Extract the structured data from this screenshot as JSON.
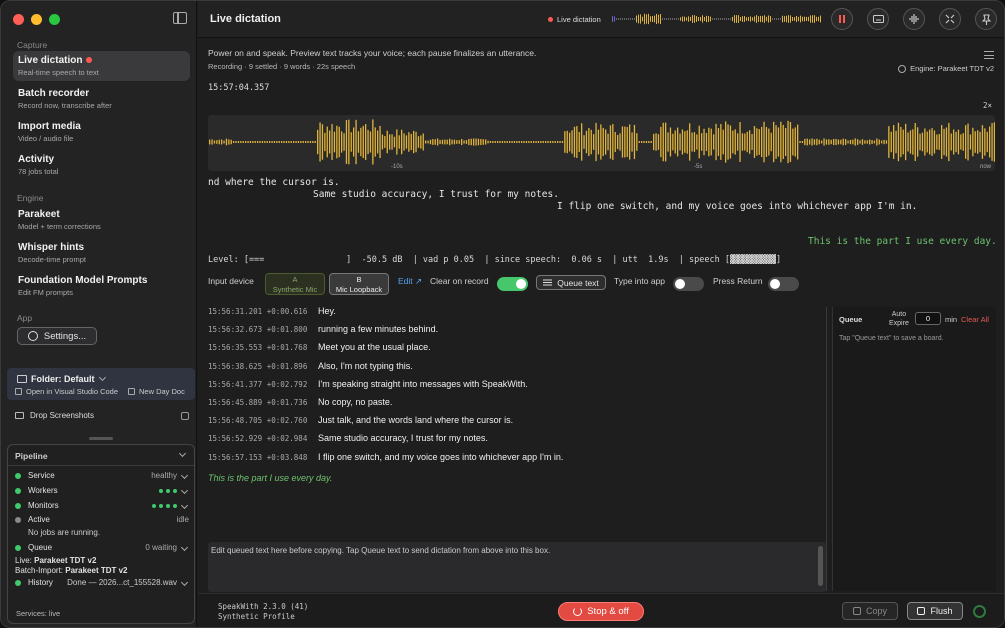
{
  "window": {
    "title": "Live dictation",
    "live_indicator": "Live dictation"
  },
  "sidebar": {
    "sections": {
      "capture": "Capture",
      "engine": "Engine",
      "app": "App"
    },
    "capture_items": [
      {
        "title": "Live dictation",
        "subtitle": "Real-time speech to text"
      },
      {
        "title": "Batch recorder",
        "subtitle": "Record now, transcribe after"
      },
      {
        "title": "Import media",
        "subtitle": "Video / audio file"
      },
      {
        "title": "Activity",
        "subtitle": "78 jobs total"
      }
    ],
    "engine_items": [
      {
        "title": "Parakeet",
        "subtitle": "Model + term corrections"
      },
      {
        "title": "Whisper hints",
        "subtitle": "Decode-time prompt"
      },
      {
        "title": "Foundation Model Prompts",
        "subtitle": "Edit FM prompts"
      }
    ],
    "settings_label": "Settings...",
    "folder": {
      "label": "Folder: Default",
      "open_vscode": "Open in Visual Studio Code",
      "new_day_doc": "New Day Doc"
    },
    "drop_screenshots": "Drop Screenshots",
    "pipeline": {
      "title": "Pipeline",
      "service": {
        "label": "Service",
        "value": "healthy"
      },
      "workers": {
        "label": "Workers"
      },
      "monitors": {
        "label": "Monitors"
      },
      "active": {
        "label": "Active",
        "value": "idle",
        "note": "No jobs are running."
      },
      "queue": {
        "label": "Queue",
        "value": "0 waiting"
      },
      "live_model_label": "Live:",
      "live_model": "Parakeet TDT v2",
      "batch_model_label": "Batch-Import:",
      "batch_model": "Parakeet TDT v2",
      "history": {
        "label": "History",
        "value": "Done — 2026...ct_155528.wav"
      }
    },
    "services": "Services: live"
  },
  "main": {
    "subtitle": "Power on and speak. Preview text tracks your voice; each pause finalizes an utterance.",
    "status": "Recording · 9 settled · 9 words · 22s speech",
    "engine": "Engine: Parakeet TDT v2",
    "timestamp": "15:57:04.357",
    "zoom": "2×",
    "wave_labels": {
      "a": "-10s",
      "b": "-5s",
      "c": "now"
    },
    "transcript": {
      "line1": "nd where the cursor is.",
      "line2": "Same studio accuracy, I trust for my notes.",
      "line3": "I flip one switch, and my voice goes into whichever app I'm in.",
      "line4": "This is the part I use every day."
    },
    "level_line": "Level: [===                ]  -50.5 dB  | vad p 0.05  | since speech:  0.06 s  | utt  1.9s  | speech [▓▓▓▓▓▓▓▓▓]",
    "controls": {
      "input_device": "Input device",
      "source_a_key": "A",
      "source_a": "Synthetic Mic",
      "source_b_key": "B",
      "source_b": "Mic Loopback",
      "edit": "Edit ↗",
      "clear_on_record": "Clear on record",
      "queue_text": "Queue text",
      "type_into_app": "Type into app",
      "press_return": "Press Return"
    },
    "log": [
      {
        "ts": "15:56:31.201 +0:00.616",
        "text": "Hey."
      },
      {
        "ts": "15:56:32.673 +0:01.800",
        "text": "running a few minutes behind."
      },
      {
        "ts": "15:56:35.553 +0:01.768",
        "text": "Meet you at the usual place."
      },
      {
        "ts": "15:56:38.625 +0:01.896",
        "text": "Also, I'm not typing this."
      },
      {
        "ts": "15:56:41.377 +0:02.792",
        "text": "I'm speaking straight into messages with SpeakWith."
      },
      {
        "ts": "15:56:45.889 +0:01.736",
        "text": "No copy, no paste."
      },
      {
        "ts": "15:56:48.705 +0:02.760",
        "text": "Just talk, and the words land where the cursor is."
      },
      {
        "ts": "15:56:52.929 +0:02.984",
        "text": "Same studio accuracy, I trust for my notes."
      },
      {
        "ts": "15:56:57.153 +0:03.848",
        "text": "I flip one switch, and my voice goes into whichever app I'm in."
      }
    ],
    "live_line": "This is the part I use every day.",
    "queue_panel": {
      "title": "Queue",
      "auto": "Auto",
      "expire": "Expire",
      "expire_value": "0",
      "min": "min",
      "clear_all": "Clear All",
      "hint": "Tap \"Queue text\" to save a board."
    },
    "edit_placeholder": "Edit queued text here before copying. Tap Queue text to send dictation from above into this box.",
    "footer": {
      "version": "SpeakWith 2.3.0 (41)",
      "profile": "Synthetic Profile",
      "stop": "Stop & off",
      "copy": "Copy",
      "flush": "Flush"
    }
  },
  "colors": {
    "accent_green": "#46c76c",
    "record_red": "#e34a42",
    "wave_gold": "#e0b43a",
    "link_blue": "#5aa2f0"
  }
}
